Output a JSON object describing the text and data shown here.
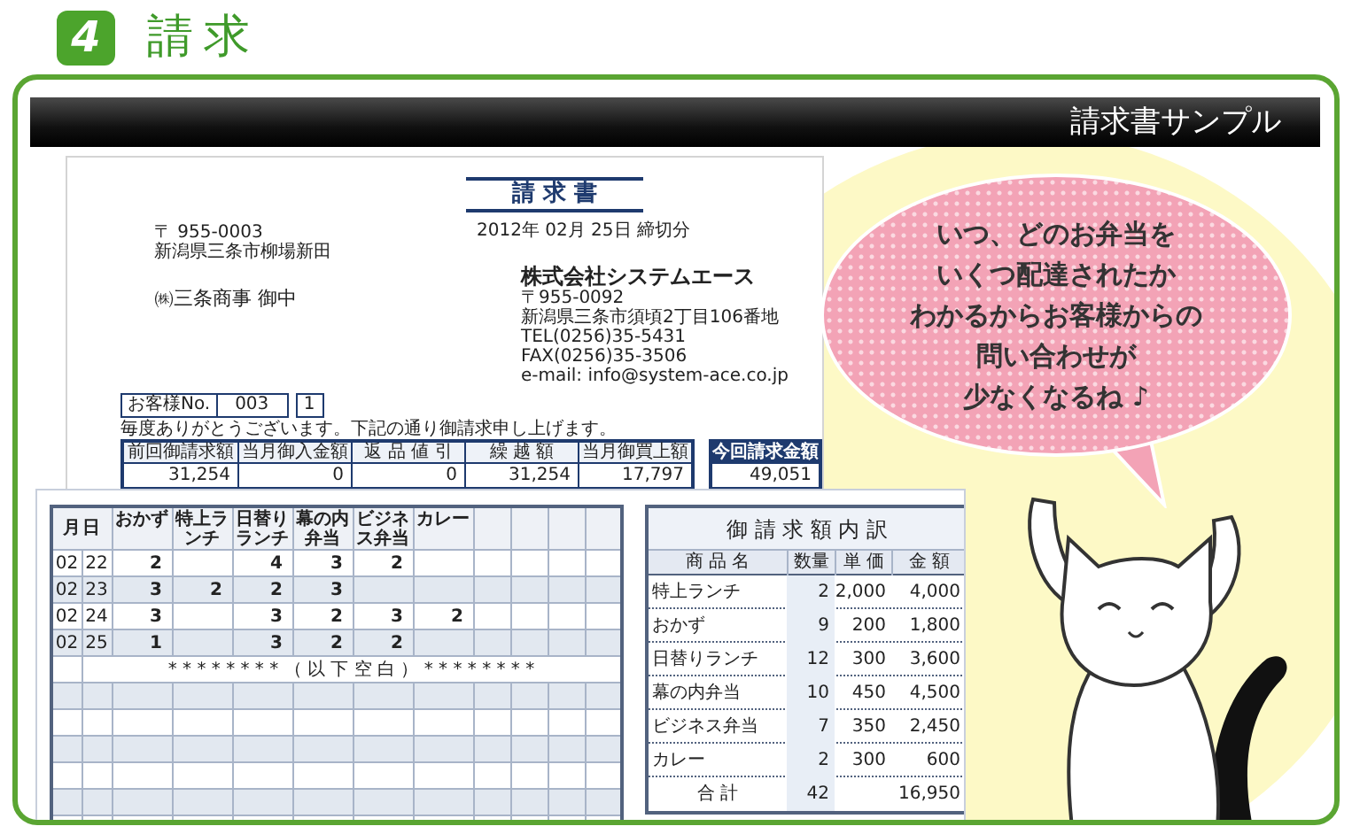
{
  "heading": {
    "step": "4",
    "title": "請求"
  },
  "banner": {
    "title": "請求書サンプル"
  },
  "invoice": {
    "recipient_postal": "〒 955-0003",
    "recipient_address": "新潟県三条市柳場新田",
    "recipient_name": "㈱三条商事 御中",
    "title": "請 求 書",
    "closing_date": "2012年 02月 25日 締切分",
    "issuer": {
      "name": "株式会社システムエース",
      "lines": [
        "〒955-0092",
        "新潟県三条市須頃2丁目106番地",
        "TEL(0256)35-5431",
        "FAX(0256)35-3506",
        "e-mail: info@system-ace.co.jp"
      ]
    },
    "customer_no_label": "お客様No.",
    "customer_no": "003",
    "page": "1",
    "greeting": "毎度ありがとうございます。下記の通り御請求申し上げます。",
    "summary": {
      "columns": [
        "前回御請求額",
        "当月御入金額",
        "返 品 値 引",
        "繰 越 額",
        "当月御買上額"
      ],
      "values": [
        "31,254",
        "0",
        "0",
        "31,254",
        "17,797"
      ]
    },
    "total": {
      "label": "今回請求金額",
      "value": "49,051"
    }
  },
  "detail_table": {
    "date_header": "月日",
    "columns": [
      "おかず",
      "特上ランチ",
      "日替りランチ",
      "幕の内弁当",
      "ビジネス弁当",
      "カレー"
    ],
    "rows": [
      {
        "month": "02",
        "day": "22",
        "cells": [
          "2",
          null,
          "4",
          "3",
          "2",
          null
        ]
      },
      {
        "month": "02",
        "day": "23",
        "cells": [
          "3",
          "2",
          "2",
          "3",
          null,
          null
        ]
      },
      {
        "month": "02",
        "day": "24",
        "cells": [
          "3",
          null,
          "3",
          "2",
          "3",
          "2"
        ]
      },
      {
        "month": "02",
        "day": "25",
        "cells": [
          "1",
          null,
          "3",
          "2",
          "2",
          null
        ]
      }
    ],
    "blank_note": "* * * * * * * * （ 以 下 空 白 ） * * * * * * * *"
  },
  "breakdown": {
    "title": "御 請 求 額 内 訳",
    "columns": [
      "商 品 名",
      "数量",
      "単 価",
      "金 額"
    ],
    "items": [
      {
        "name": "特上ランチ",
        "qty": "2",
        "price": "2,000",
        "amount": "4,000"
      },
      {
        "name": "おかず",
        "qty": "9",
        "price": "200",
        "amount": "1,800"
      },
      {
        "name": "日替りランチ",
        "qty": "12",
        "price": "300",
        "amount": "3,600"
      },
      {
        "name": "幕の内弁当",
        "qty": "10",
        "price": "450",
        "amount": "4,500"
      },
      {
        "name": "ビジネス弁当",
        "qty": "7",
        "price": "350",
        "amount": "2,450"
      },
      {
        "name": "カレー",
        "qty": "2",
        "price": "300",
        "amount": "600"
      }
    ],
    "total": {
      "label": "合 計",
      "qty": "42",
      "amount": "16,950"
    }
  },
  "speech_bubble": {
    "lines": [
      "いつ、どのお弁当を",
      "いくつ配達されたか",
      "わかるからお客様からの",
      "問い合わせが",
      "少なくなるね ♪"
    ]
  }
}
